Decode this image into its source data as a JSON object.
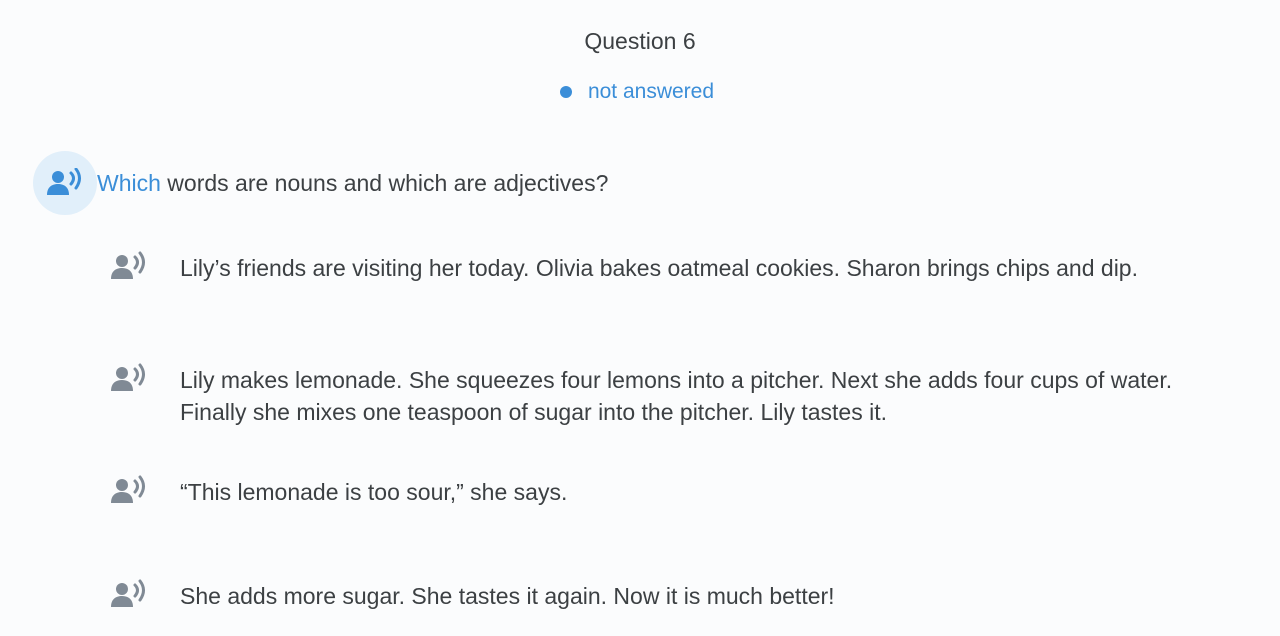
{
  "question": {
    "title": "Question 6",
    "status": "not answered"
  },
  "prompt": {
    "highlight": "Which",
    "rest": " words are nouns and which are adjectives?"
  },
  "sentences": [
    "Lily’s friends are visiting her today. Olivia bakes oatmeal cookies. Sharon brings chips and dip.",
    "Lily makes lemonade. She squeezes four lemons into a pitcher. Next she adds four cups of water. Finally she mixes one teaspoon of sugar into the pitcher. Lily tastes it.",
    "“This lemonade is too sour,” she says.",
    "She adds more sugar. She tastes it again. Now it is much better!"
  ],
  "icons": {
    "prompt_audio": "speaker-person-icon",
    "sentence_audio": "speaker-person-icon"
  },
  "colors": {
    "accent": "#3b8ed8",
    "text": "#3c4043",
    "icon_gray": "#808a95",
    "prompt_icon_bg": "#e1effa"
  }
}
